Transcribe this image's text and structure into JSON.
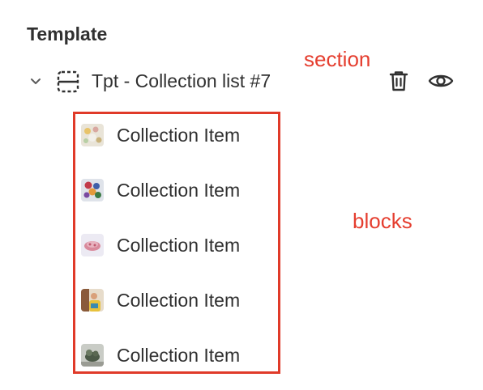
{
  "panel": {
    "heading": "Template"
  },
  "section": {
    "title": "Tpt - Collection list #7",
    "icons": {
      "toggle": "chevron-down-icon",
      "type": "section-icon",
      "delete": "trash-icon",
      "visibility": "eye-icon"
    }
  },
  "annotations": {
    "section_label": "section",
    "blocks_label": "blocks",
    "color": "#e53e2f"
  },
  "blocks": [
    {
      "label": "Collection Item",
      "thumbnail": "collection-thumbnail-1"
    },
    {
      "label": "Collection Item",
      "thumbnail": "collection-thumbnail-2"
    },
    {
      "label": "Collection Item",
      "thumbnail": "collection-thumbnail-3"
    },
    {
      "label": "Collection Item",
      "thumbnail": "collection-thumbnail-4"
    },
    {
      "label": "Collection Item",
      "thumbnail": "collection-thumbnail-5"
    }
  ]
}
